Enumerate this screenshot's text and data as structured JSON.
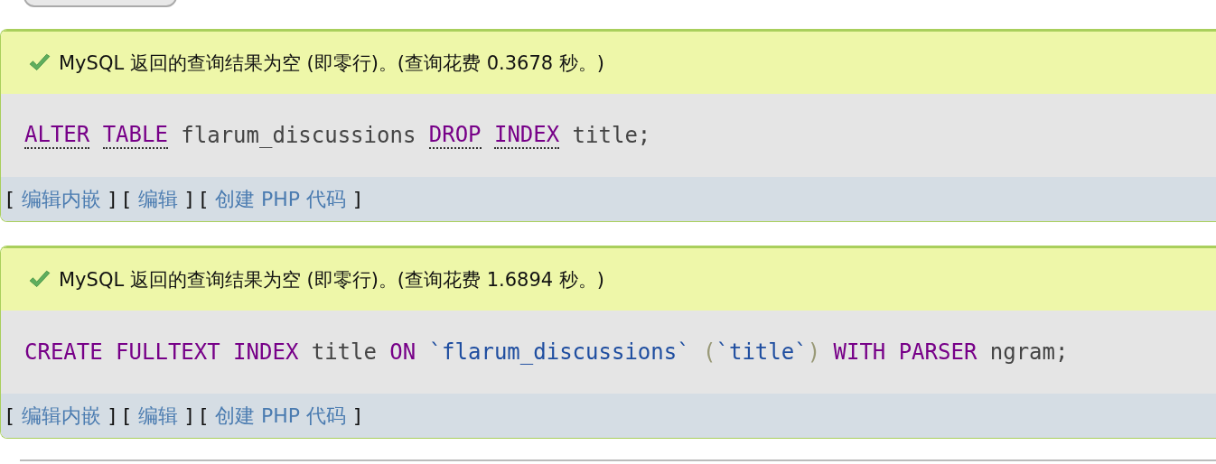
{
  "results": [
    {
      "message": "MySQL 返回的查询结果为空 (即零行)。(查询花费 0.3678 秒。)",
      "sql": [
        [
          {
            "kind": "keyword",
            "text": "ALTER",
            "linked": true
          }
        ],
        [
          {
            "kind": "keyword",
            "text": "TABLE",
            "linked": true
          }
        ],
        [
          {
            "kind": "plain",
            "text": "flarum_discussions"
          }
        ],
        [
          {
            "kind": "keyword",
            "text": "DROP",
            "linked": true
          }
        ],
        [
          {
            "kind": "keyword",
            "text": "INDEX",
            "linked": true
          }
        ],
        [
          {
            "kind": "plain",
            "text": "title;"
          }
        ]
      ],
      "links": [
        "编辑内嵌",
        "编辑",
        "创建 PHP 代码"
      ]
    },
    {
      "message": "MySQL 返回的查询结果为空 (即零行)。(查询花费 1.6894 秒。)",
      "sql": [
        [
          {
            "kind": "keyword",
            "text": "CREATE",
            "linked": false
          }
        ],
        [
          {
            "kind": "keyword",
            "text": "FULLTEXT",
            "linked": false
          }
        ],
        [
          {
            "kind": "keyword",
            "text": "INDEX",
            "linked": false
          }
        ],
        [
          {
            "kind": "plain",
            "text": "title"
          }
        ],
        [
          {
            "kind": "keyword",
            "text": "ON",
            "linked": false
          }
        ],
        [
          {
            "kind": "name",
            "text": "`flarum_discussions`"
          }
        ],
        [
          {
            "kind": "paren",
            "text": "("
          },
          {
            "kind": "name",
            "text": "`title`"
          },
          {
            "kind": "paren",
            "text": ")"
          }
        ],
        [
          {
            "kind": "keyword",
            "text": "WITH",
            "linked": false
          }
        ],
        [
          {
            "kind": "keyword",
            "text": "PARSER",
            "linked": false
          }
        ],
        [
          {
            "kind": "plain",
            "text": "ngram;"
          }
        ]
      ],
      "links": [
        "编辑内嵌",
        "编辑",
        "创建 PHP 代码"
      ]
    }
  ],
  "brackets": {
    "open": "[",
    "close": "]"
  }
}
